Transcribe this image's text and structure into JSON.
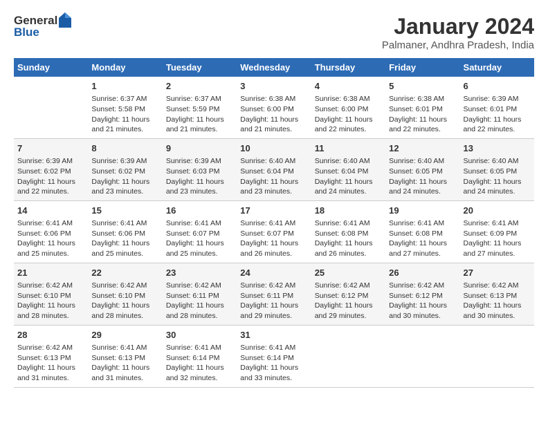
{
  "header": {
    "logo": {
      "general": "General",
      "blue": "Blue"
    },
    "title": "January 2024",
    "subtitle": "Palmaner, Andhra Pradesh, India"
  },
  "calendar": {
    "headers": [
      "Sunday",
      "Monday",
      "Tuesday",
      "Wednesday",
      "Thursday",
      "Friday",
      "Saturday"
    ],
    "rows": [
      [
        {
          "day": "",
          "content": ""
        },
        {
          "day": "1",
          "content": "Sunrise: 6:37 AM\nSunset: 5:58 PM\nDaylight: 11 hours and 21 minutes."
        },
        {
          "day": "2",
          "content": "Sunrise: 6:37 AM\nSunset: 5:59 PM\nDaylight: 11 hours and 21 minutes."
        },
        {
          "day": "3",
          "content": "Sunrise: 6:38 AM\nSunset: 6:00 PM\nDaylight: 11 hours and 21 minutes."
        },
        {
          "day": "4",
          "content": "Sunrise: 6:38 AM\nSunset: 6:00 PM\nDaylight: 11 hours and 22 minutes."
        },
        {
          "day": "5",
          "content": "Sunrise: 6:38 AM\nSunset: 6:01 PM\nDaylight: 11 hours and 22 minutes."
        },
        {
          "day": "6",
          "content": "Sunrise: 6:39 AM\nSunset: 6:01 PM\nDaylight: 11 hours and 22 minutes."
        }
      ],
      [
        {
          "day": "7",
          "content": "Sunrise: 6:39 AM\nSunset: 6:02 PM\nDaylight: 11 hours and 22 minutes."
        },
        {
          "day": "8",
          "content": "Sunrise: 6:39 AM\nSunset: 6:02 PM\nDaylight: 11 hours and 23 minutes."
        },
        {
          "day": "9",
          "content": "Sunrise: 6:39 AM\nSunset: 6:03 PM\nDaylight: 11 hours and 23 minutes."
        },
        {
          "day": "10",
          "content": "Sunrise: 6:40 AM\nSunset: 6:04 PM\nDaylight: 11 hours and 23 minutes."
        },
        {
          "day": "11",
          "content": "Sunrise: 6:40 AM\nSunset: 6:04 PM\nDaylight: 11 hours and 24 minutes."
        },
        {
          "day": "12",
          "content": "Sunrise: 6:40 AM\nSunset: 6:05 PM\nDaylight: 11 hours and 24 minutes."
        },
        {
          "day": "13",
          "content": "Sunrise: 6:40 AM\nSunset: 6:05 PM\nDaylight: 11 hours and 24 minutes."
        }
      ],
      [
        {
          "day": "14",
          "content": "Sunrise: 6:41 AM\nSunset: 6:06 PM\nDaylight: 11 hours and 25 minutes."
        },
        {
          "day": "15",
          "content": "Sunrise: 6:41 AM\nSunset: 6:06 PM\nDaylight: 11 hours and 25 minutes."
        },
        {
          "day": "16",
          "content": "Sunrise: 6:41 AM\nSunset: 6:07 PM\nDaylight: 11 hours and 25 minutes."
        },
        {
          "day": "17",
          "content": "Sunrise: 6:41 AM\nSunset: 6:07 PM\nDaylight: 11 hours and 26 minutes."
        },
        {
          "day": "18",
          "content": "Sunrise: 6:41 AM\nSunset: 6:08 PM\nDaylight: 11 hours and 26 minutes."
        },
        {
          "day": "19",
          "content": "Sunrise: 6:41 AM\nSunset: 6:08 PM\nDaylight: 11 hours and 27 minutes."
        },
        {
          "day": "20",
          "content": "Sunrise: 6:41 AM\nSunset: 6:09 PM\nDaylight: 11 hours and 27 minutes."
        }
      ],
      [
        {
          "day": "21",
          "content": "Sunrise: 6:42 AM\nSunset: 6:10 PM\nDaylight: 11 hours and 28 minutes."
        },
        {
          "day": "22",
          "content": "Sunrise: 6:42 AM\nSunset: 6:10 PM\nDaylight: 11 hours and 28 minutes."
        },
        {
          "day": "23",
          "content": "Sunrise: 6:42 AM\nSunset: 6:11 PM\nDaylight: 11 hours and 28 minutes."
        },
        {
          "day": "24",
          "content": "Sunrise: 6:42 AM\nSunset: 6:11 PM\nDaylight: 11 hours and 29 minutes."
        },
        {
          "day": "25",
          "content": "Sunrise: 6:42 AM\nSunset: 6:12 PM\nDaylight: 11 hours and 29 minutes."
        },
        {
          "day": "26",
          "content": "Sunrise: 6:42 AM\nSunset: 6:12 PM\nDaylight: 11 hours and 30 minutes."
        },
        {
          "day": "27",
          "content": "Sunrise: 6:42 AM\nSunset: 6:13 PM\nDaylight: 11 hours and 30 minutes."
        }
      ],
      [
        {
          "day": "28",
          "content": "Sunrise: 6:42 AM\nSunset: 6:13 PM\nDaylight: 11 hours and 31 minutes."
        },
        {
          "day": "29",
          "content": "Sunrise: 6:41 AM\nSunset: 6:13 PM\nDaylight: 11 hours and 31 minutes."
        },
        {
          "day": "30",
          "content": "Sunrise: 6:41 AM\nSunset: 6:14 PM\nDaylight: 11 hours and 32 minutes."
        },
        {
          "day": "31",
          "content": "Sunrise: 6:41 AM\nSunset: 6:14 PM\nDaylight: 11 hours and 33 minutes."
        },
        {
          "day": "",
          "content": ""
        },
        {
          "day": "",
          "content": ""
        },
        {
          "day": "",
          "content": ""
        }
      ]
    ]
  }
}
